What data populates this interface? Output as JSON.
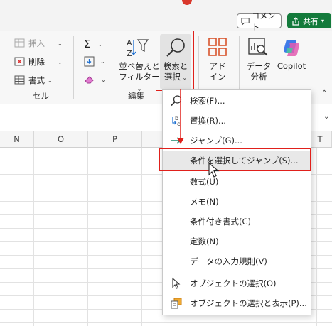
{
  "header": {
    "comment_label": "コメント",
    "share_label": "共有"
  },
  "ribbon": {
    "cells": {
      "insert_label": "挿入",
      "delete_label": "削除",
      "format_label": "書式",
      "group_label": "セル"
    },
    "editing": {
      "sort_filter_label_1": "並べ替えと",
      "sort_filter_label_2": "フィルター",
      "find_select_label_1": "検索と",
      "find_select_label_2": "選択",
      "group_label": "編集"
    },
    "addins": {
      "label_1": "アド",
      "label_2": "イン"
    },
    "analysis": {
      "label_1": "データ",
      "label_2": "分析"
    },
    "copilot": {
      "label": "Copilot"
    }
  },
  "grid": {
    "columns": [
      "N",
      "O",
      "P",
      "T"
    ]
  },
  "menu": {
    "items": [
      {
        "label": "検索(F)...",
        "icon": "magnifier-icon"
      },
      {
        "label": "置換(R)...",
        "icon": "replace-icon"
      },
      {
        "label": "ジャンプ(G)...",
        "icon": "jump-arrow-icon"
      },
      {
        "label": "条件を選択してジャンプ(S)...",
        "icon": ""
      },
      {
        "label": "数式(U)",
        "icon": ""
      },
      {
        "label": "メモ(N)",
        "icon": ""
      },
      {
        "label": "条件付き書式(C)",
        "icon": ""
      },
      {
        "label": "定数(N)",
        "icon": ""
      },
      {
        "label": "データの入力規則(V)",
        "icon": ""
      },
      {
        "label": "オブジェクトの選択(O)",
        "icon": "pointer-icon"
      },
      {
        "label": "オブジェクトの選択と表示(P)...",
        "icon": "selection-pane-icon"
      }
    ]
  },
  "colors": {
    "highlight_red": "#e0201b",
    "share_green": "#137a3b",
    "accent_red": "#d9382c"
  }
}
